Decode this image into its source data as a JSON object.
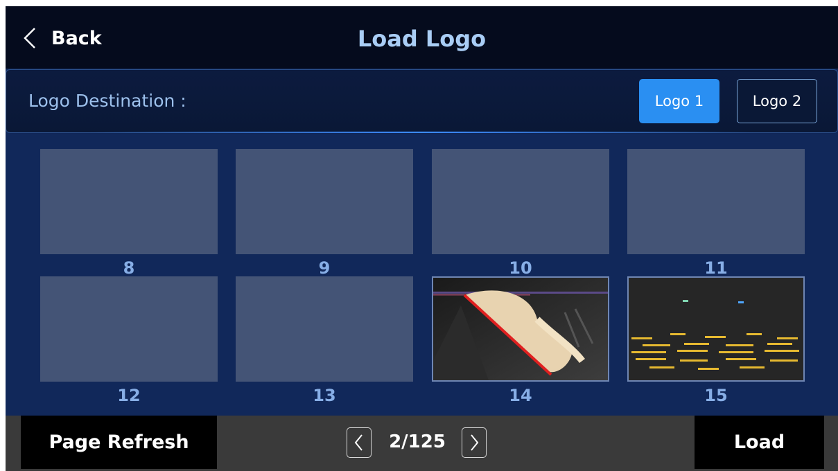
{
  "header": {
    "back_label": "Back",
    "title": "Load Logo"
  },
  "destination": {
    "label": "Logo Destination :",
    "options": [
      "Logo 1",
      "Logo 2"
    ],
    "selected": "Logo 1"
  },
  "grid": {
    "items": [
      {
        "number": "8"
      },
      {
        "number": "9"
      },
      {
        "number": "10"
      },
      {
        "number": "11"
      },
      {
        "number": "12"
      },
      {
        "number": "13"
      },
      {
        "number": "14"
      },
      {
        "number": "15"
      }
    ]
  },
  "footer": {
    "refresh_label": "Page Refresh",
    "page_indicator": "2/125",
    "load_label": "Load"
  },
  "colors": {
    "accent": "#2a8ff2",
    "background": "#11285a",
    "header": "#050b1d",
    "empty_slot": "#445476"
  }
}
